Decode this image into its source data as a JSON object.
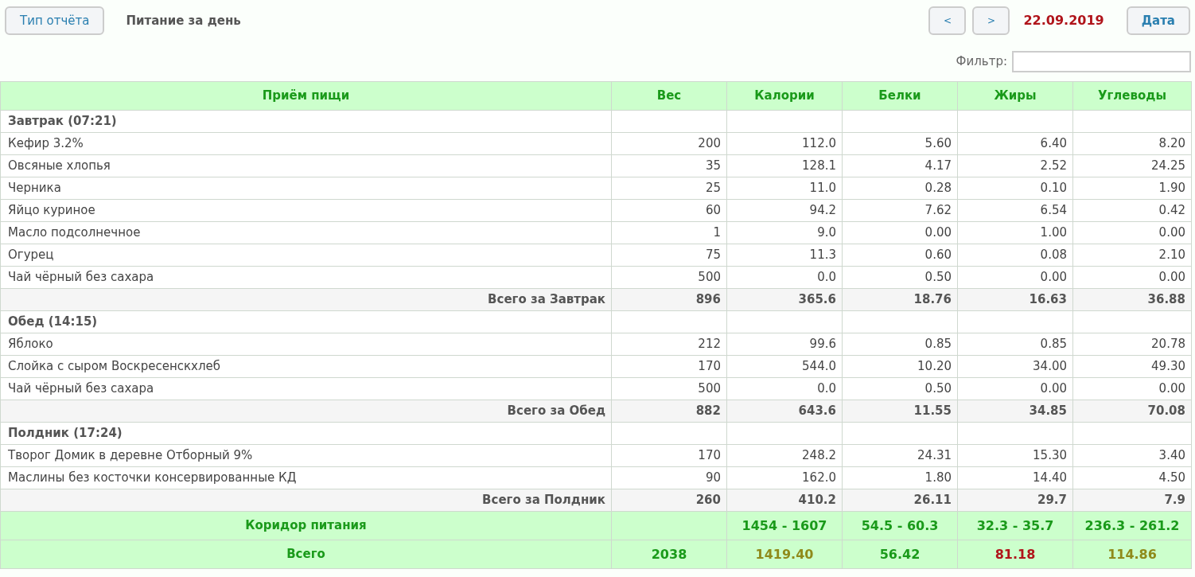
{
  "toolbar": {
    "report_type_button": "Тип отчёта",
    "report_title": "Питание за день",
    "prev_button": "<",
    "next_button": ">",
    "date": "22.09.2019",
    "date_button": "Дата"
  },
  "filter": {
    "label": "Фильтр:"
  },
  "table": {
    "columns": [
      "Приём пищи",
      "Вес",
      "Калории",
      "Белки",
      "Жиры",
      "Углеводы"
    ],
    "meals": [
      {
        "title": "Завтрак (07:21)",
        "items": [
          {
            "name": "Кефир 3.2%",
            "values": [
              "200",
              "112.0",
              "5.60",
              "6.40",
              "8.20"
            ]
          },
          {
            "name": "Овсяные хлопья",
            "values": [
              "35",
              "128.1",
              "4.17",
              "2.52",
              "24.25"
            ]
          },
          {
            "name": "Черника",
            "values": [
              "25",
              "11.0",
              "0.28",
              "0.10",
              "1.90"
            ]
          },
          {
            "name": "Яйцо куриное",
            "values": [
              "60",
              "94.2",
              "7.62",
              "6.54",
              "0.42"
            ]
          },
          {
            "name": "Масло подсолнечное",
            "values": [
              "1",
              "9.0",
              "0.00",
              "1.00",
              "0.00"
            ]
          },
          {
            "name": "Огурец",
            "values": [
              "75",
              "11.3",
              "0.60",
              "0.08",
              "2.10"
            ]
          },
          {
            "name": "Чай чёрный без сахара",
            "values": [
              "500",
              "0.0",
              "0.50",
              "0.00",
              "0.00"
            ]
          }
        ],
        "total": {
          "label": "Всего за Завтрак",
          "values": [
            "896",
            "365.6",
            "18.76",
            "16.63",
            "36.88"
          ]
        }
      },
      {
        "title": "Обед (14:15)",
        "items": [
          {
            "name": "Яблоко",
            "values": [
              "212",
              "99.6",
              "0.85",
              "0.85",
              "20.78"
            ]
          },
          {
            "name": "Слойка с сыром Воскресенскхлеб",
            "values": [
              "170",
              "544.0",
              "10.20",
              "34.00",
              "49.30"
            ]
          },
          {
            "name": "Чай чёрный без сахара",
            "values": [
              "500",
              "0.0",
              "0.50",
              "0.00",
              "0.00"
            ]
          }
        ],
        "total": {
          "label": "Всего за Обед",
          "values": [
            "882",
            "643.6",
            "11.55",
            "34.85",
            "70.08"
          ]
        }
      },
      {
        "title": "Полдник (17:24)",
        "items": [
          {
            "name": "Творог Домик в деревне Отборный 9%",
            "values": [
              "170",
              "248.2",
              "24.31",
              "15.30",
              "3.40"
            ]
          },
          {
            "name": "Маслины без косточки консервированные КД",
            "values": [
              "90",
              "162.0",
              "1.80",
              "14.40",
              "4.50"
            ]
          }
        ],
        "total": {
          "label": "Всего за Полдник",
          "values": [
            "260",
            "410.2",
            "26.11",
            "29.7",
            "7.9"
          ]
        }
      }
    ],
    "corridor": {
      "label": "Коридор питания",
      "values": [
        "1454 - 1607",
        "54.5 - 60.3",
        "32.3 - 35.7",
        "236.3 - 261.2"
      ]
    },
    "grand_total": {
      "label": "Всего",
      "cells": [
        {
          "value": "2038",
          "color": "#1a9a1a"
        },
        {
          "value": "1419.40",
          "color": "#8f8a1a"
        },
        {
          "value": "56.42",
          "color": "#1a9a1a"
        },
        {
          "value": "81.18",
          "color": "#b0141a"
        },
        {
          "value": "114.86",
          "color": "#8f8a1a"
        }
      ]
    }
  }
}
